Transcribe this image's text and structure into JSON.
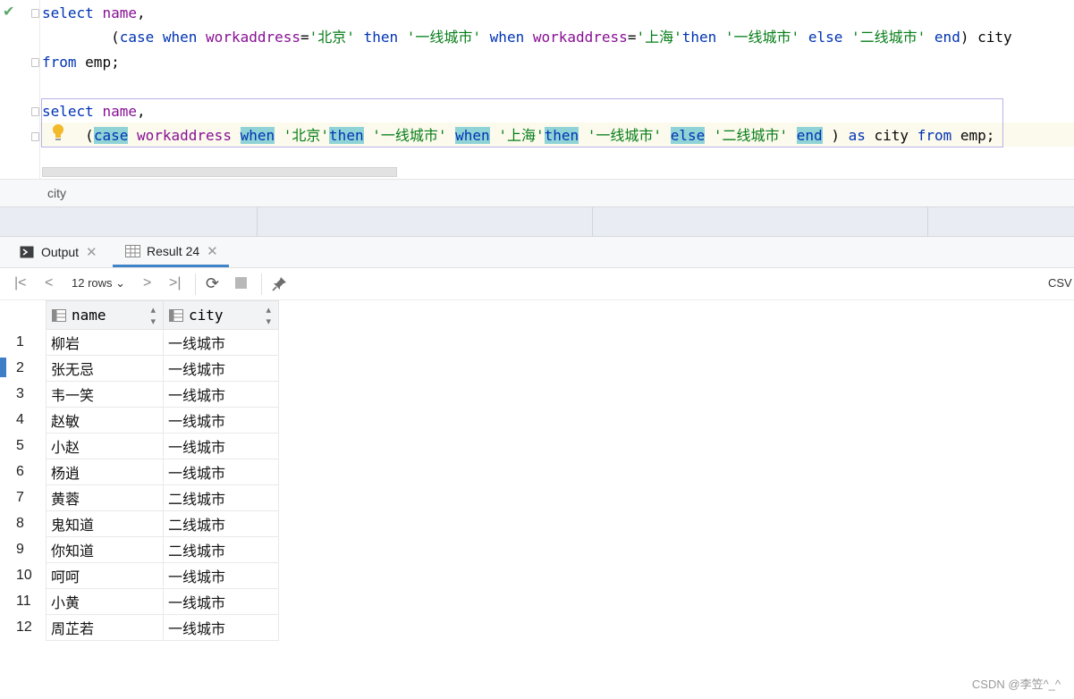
{
  "editor": {
    "line1": {
      "k1": "select",
      "c1": "name",
      "p1": ","
    },
    "line2": {
      "open": "(",
      "case": "case",
      "when1": "when",
      "col1": "workaddress",
      "eq1": "=",
      "v1": "'北京'",
      "then1": "then",
      "r1": "'一线城市'",
      "when2": "when",
      "col2": "workaddress",
      "eq2": "=",
      "v2": "'上海'",
      "then2": "then",
      "r2": "'一线城市'",
      "else": "else",
      "r3": "'二线城市'",
      "end": "end",
      "close": ")",
      "alias": "city"
    },
    "line3": {
      "from": "from",
      "table": "emp;"
    },
    "line4": {
      "k1": "select",
      "c1": "name",
      "p1": ","
    },
    "line5": {
      "open": "(",
      "case": "case",
      "col": "workaddress",
      "when1": "when",
      "v1": "'北京'",
      "then1": "then",
      "r1": "'一线城市'",
      "when2": "when",
      "v2": "'上海'",
      "then2": "then",
      "r2": "'一线城市'",
      "else": "else",
      "r3": "'二线城市'",
      "end": "end",
      "close": ")",
      "as": "as",
      "alias": "city",
      "from": "from",
      "table": "emp;"
    }
  },
  "breadcrumb": "city",
  "tabs": [
    {
      "label": "Output",
      "icon": "terminal-icon"
    },
    {
      "label": "Result 24",
      "icon": "table-icon"
    }
  ],
  "toolbar": {
    "rows_label": "12 rows",
    "export_label": "CSV"
  },
  "columns": [
    "name",
    "city"
  ],
  "rows": [
    {
      "n": "1",
      "name": "柳岩",
      "city": "一线城市"
    },
    {
      "n": "2",
      "name": "张无忌",
      "city": "一线城市"
    },
    {
      "n": "3",
      "name": "韦一笑",
      "city": "一线城市"
    },
    {
      "n": "4",
      "name": "赵敏",
      "city": "一线城市"
    },
    {
      "n": "5",
      "name": "小赵",
      "city": "一线城市"
    },
    {
      "n": "6",
      "name": "杨逍",
      "city": "一线城市"
    },
    {
      "n": "7",
      "name": "黄蓉",
      "city": "二线城市"
    },
    {
      "n": "8",
      "name": "鬼知道",
      "city": "二线城市"
    },
    {
      "n": "9",
      "name": "你知道",
      "city": "二线城市"
    },
    {
      "n": "10",
      "name": "呵呵",
      "city": "一线城市"
    },
    {
      "n": "11",
      "name": "小黄",
      "city": "一线城市"
    },
    {
      "n": "12",
      "name": "周芷若",
      "city": "一线城市"
    }
  ],
  "watermark": "CSDN @李笠^_^",
  "colors": {
    "keyword": "#0033b3",
    "identifier": "#871094",
    "string": "#067d17",
    "highlight": "#8fd3d6",
    "accent": "#4083c9"
  }
}
